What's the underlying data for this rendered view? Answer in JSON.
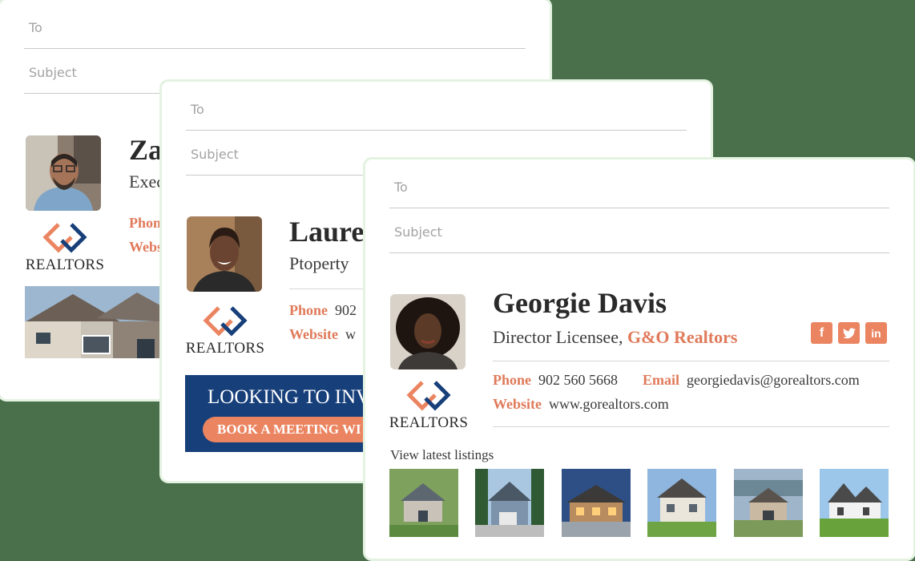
{
  "email": {
    "to_placeholder": "To",
    "subject_placeholder": "Subject"
  },
  "brand": {
    "logo_word": "REALTORS",
    "accent": "#eb8460",
    "navy": "#173f7a"
  },
  "card1": {
    "name": "Za",
    "title": "Exec",
    "phone_label": "Phon",
    "website_label": "Webs"
  },
  "card2": {
    "name": "Laure",
    "title": "Ptoperty",
    "phone_label": "Phone",
    "phone_value": "902",
    "website_label": "Website",
    "website_value": "w",
    "banner_headline": "LOOKING TO INV",
    "banner_cta": "BOOK A MEETING WI"
  },
  "card3": {
    "name": "Georgie Davis",
    "title_prefix": "Director Licensee,",
    "company": "G&O Realtors",
    "phone_label": "Phone",
    "phone_value": "902 560 5668",
    "email_label": "Email",
    "email_value": "georgiedavis@gorealtors.com",
    "website_label": "Website",
    "website_value": "www.gorealtors.com",
    "listings_label": "View latest listings",
    "social": [
      "facebook-icon",
      "twitter-icon",
      "linkedin-icon"
    ],
    "social_letters": {
      "facebook": "f",
      "linkedin": "in"
    }
  }
}
